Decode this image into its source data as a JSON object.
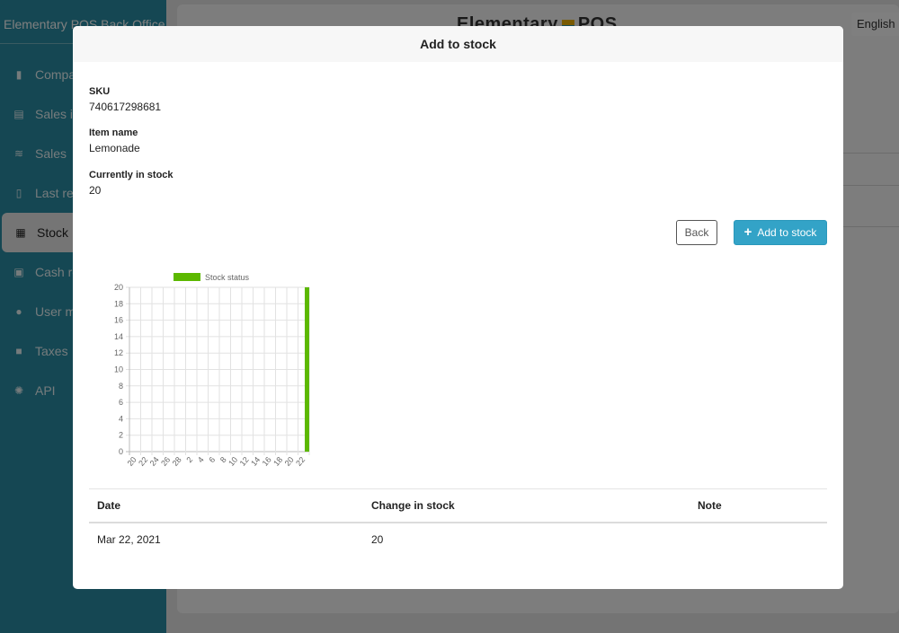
{
  "sidebar": {
    "brand": "Elementary POS Back Office",
    "items": [
      {
        "label": "Company",
        "icon": "building-icon"
      },
      {
        "label": "Sales items",
        "icon": "clipboard-icon"
      },
      {
        "label": "Sales",
        "icon": "coins-icon"
      },
      {
        "label": "Last receipts",
        "icon": "receipt-icon"
      },
      {
        "label": "Stock",
        "icon": "warehouse-icon"
      },
      {
        "label": "Cash register",
        "icon": "calculator-icon"
      },
      {
        "label": "User management",
        "icon": "users-icon"
      },
      {
        "label": "Taxes",
        "icon": "briefcase-icon"
      },
      {
        "label": "API",
        "icon": "gear-icon"
      }
    ]
  },
  "header": {
    "logo_left": "Elementary",
    "logo_right": "POS",
    "language": "English"
  },
  "modal": {
    "title": "Add to stock",
    "sku_label": "SKU",
    "sku_value": "740617298681",
    "item_name_label": "Item name",
    "item_name_value": "Lemonade",
    "in_stock_label": "Currently in stock",
    "in_stock_value": "20",
    "back_label": "Back",
    "add_label": "Add to stock"
  },
  "chart_data": {
    "type": "bar",
    "legend": [
      "Stock status"
    ],
    "legend_position": "top",
    "colors": {
      "series": "#5cb800"
    },
    "categories": [
      "20",
      "22",
      "24",
      "26",
      "28",
      "2",
      "4",
      "6",
      "8",
      "10",
      "12",
      "14",
      "16",
      "18",
      "20",
      "22"
    ],
    "series": [
      {
        "name": "Stock status",
        "values": [
          0,
          0,
          0,
          0,
          0,
          0,
          0,
          0,
          0,
          0,
          0,
          0,
          0,
          0,
          0,
          20
        ]
      }
    ],
    "y_ticks": [
      "0",
      "2",
      "4",
      "6",
      "8",
      "10",
      "12",
      "14",
      "16",
      "18",
      "20"
    ],
    "ylim": [
      0,
      20
    ],
    "grid": true
  },
  "table": {
    "headers": [
      "Date",
      "Change in stock",
      "Note"
    ],
    "rows": [
      [
        "Mar 22, 2021",
        "20",
        ""
      ]
    ]
  }
}
